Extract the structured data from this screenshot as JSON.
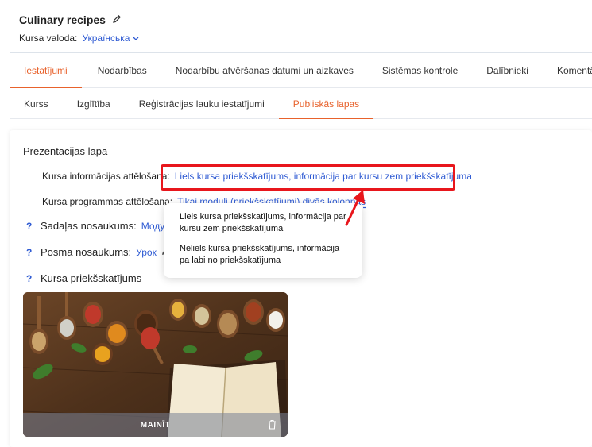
{
  "header": {
    "title": "Culinary recipes",
    "language_label": "Kursa valoda:",
    "language_value": "Українська"
  },
  "tabs": [
    {
      "label": "Iestatījumi",
      "active": true
    },
    {
      "label": "Nodarbības",
      "active": false
    },
    {
      "label": "Nodarbību atvēršanas datumi un aizkaves",
      "active": false
    },
    {
      "label": "Sistēmas kontrole",
      "active": false
    },
    {
      "label": "Dalībnieki",
      "active": false
    },
    {
      "label": "Komentāri",
      "active": false
    }
  ],
  "subtabs": [
    {
      "label": "Kurss",
      "active": false
    },
    {
      "label": "Izglītība",
      "active": false
    },
    {
      "label": "Reģistrācijas lauku iestatījumi",
      "active": false
    },
    {
      "label": "Publiskās lapas",
      "active": true
    }
  ],
  "section": {
    "title": "Prezentācijas lapa",
    "course_info_label": "Kursa informācijas attēlošana:",
    "course_info_value": "Liels kursa priekšskatījums, informācija par kursu zem priekšskatījuma",
    "program_label": "Kursa programmas attēlošana:",
    "program_value": "Tikai moduli (priekšskatījumi) divās kolonnās",
    "section_name_label": "Sadaļas nosaukums:",
    "section_name_value": "Модули",
    "step_name_label": "Posma nosaukums:",
    "step_name_value": "Урок",
    "preview_label": "Kursa priekšskatījums",
    "change_label": "MAINĪT",
    "help_mark": "?"
  },
  "dropdown": {
    "options": [
      "Liels kursa priekšskatījums, informācija par kursu zem priekšskatījuma",
      "Neliels kursa priekšskatījums, informācija pa labi no priekšskatījuma"
    ]
  },
  "colors": {
    "accent": "#e8622c",
    "link": "#2f5bd3",
    "highlight": "#e8161c"
  }
}
